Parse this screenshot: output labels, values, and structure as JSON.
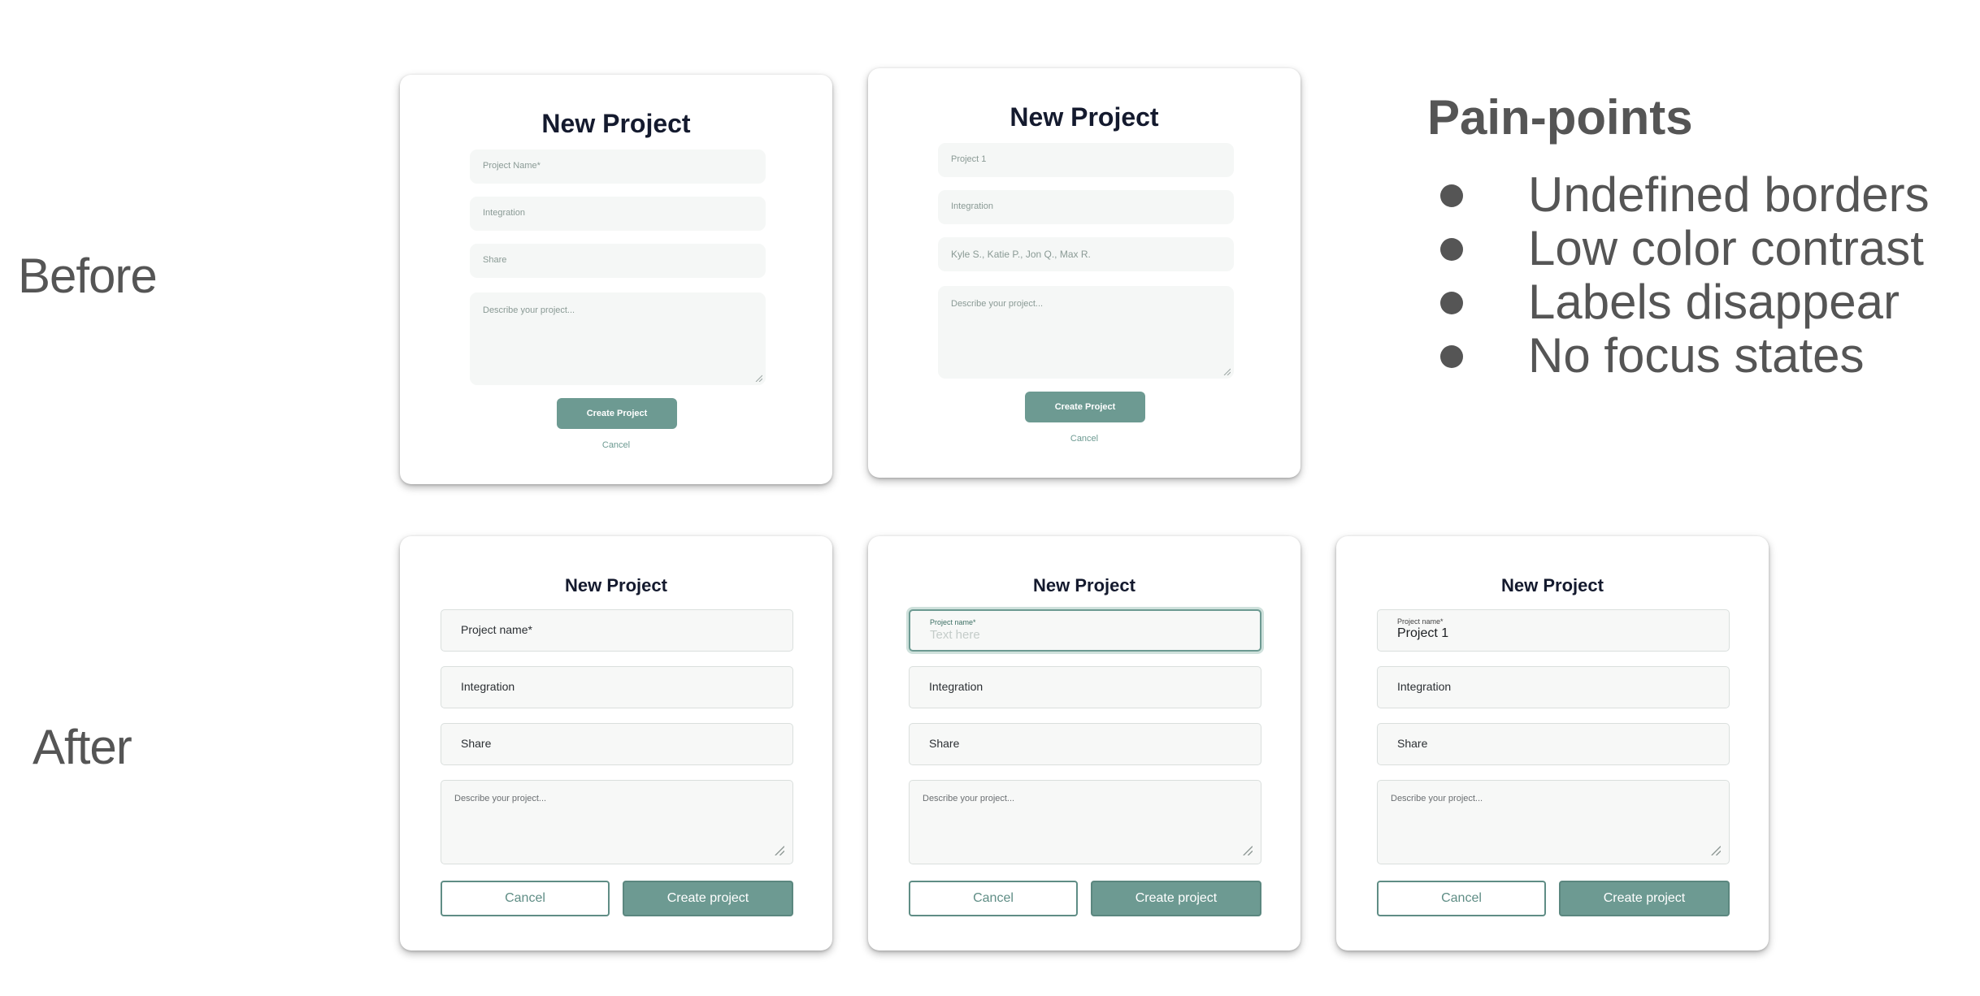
{
  "labels": {
    "before": "Before",
    "after": "After"
  },
  "pain_points": {
    "title": "Pain-points",
    "items": [
      "Undefined borders",
      "Low color contrast",
      "Labels disappear",
      "No focus states"
    ]
  },
  "before_cards": [
    {
      "title": "New Project",
      "fields": [
        "Project Name*",
        "Integration",
        "Share"
      ],
      "textarea": "Describe your project...",
      "create": "Create Project",
      "cancel": "Cancel"
    },
    {
      "title": "New Project",
      "fields": [
        "Project 1",
        "Integration",
        "Kyle S., Katie P., Jon Q., Max R."
      ],
      "textarea": "Describe your project...",
      "create": "Create Project",
      "cancel": "Cancel"
    }
  ],
  "after_cards": [
    {
      "title": "New Project",
      "project_field": "Project name*",
      "integration": "Integration",
      "share": "Share",
      "textarea": "Describe your project...",
      "cancel": "Cancel",
      "create": "Create project"
    },
    {
      "title": "New Project",
      "project_label": "Project name*",
      "project_placeholder": "Text here",
      "integration": "Integration",
      "share": "Share",
      "textarea": "Describe your project...",
      "cancel": "Cancel",
      "create": "Create project"
    },
    {
      "title": "New Project",
      "project_label": "Project name*",
      "project_value": "Project 1",
      "integration": "Integration",
      "share": "Share",
      "textarea": "Describe your project...",
      "cancel": "Cancel",
      "create": "Create project"
    }
  ]
}
